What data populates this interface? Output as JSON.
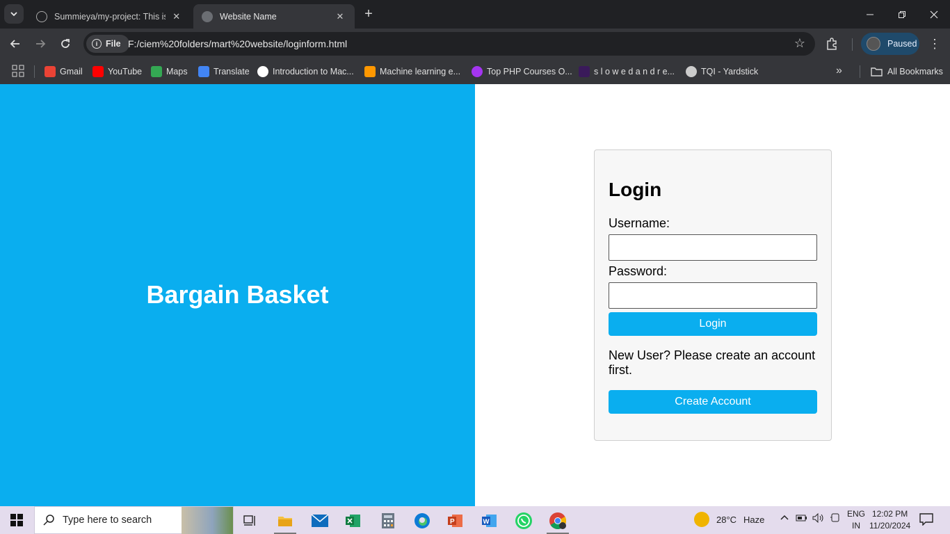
{
  "browser": {
    "tabs": [
      {
        "title": "Summieya/my-project: This is a"
      },
      {
        "title": "Website Name"
      }
    ],
    "address": {
      "chip": "File",
      "url": "F:/ciem%20folders/mart%20website/loginform.html"
    },
    "profile_label": "Paused",
    "bookmarks": [
      {
        "label": "Gmail",
        "color": "#ea4335"
      },
      {
        "label": "YouTube",
        "color": "#ff0000"
      },
      {
        "label": "Maps",
        "color": "#34a853"
      },
      {
        "label": "Translate",
        "color": "#4285f4"
      },
      {
        "label": "Introduction to Mac...",
        "color": "#ffffff"
      },
      {
        "label": "Machine learning e...",
        "color": "#ff9800"
      },
      {
        "label": "Top PHP Courses O...",
        "color": "#a435f0"
      },
      {
        "label": "s l o w e d a n d r e...",
        "color": "#3a1a5a"
      },
      {
        "label": "TQI - Yardstick",
        "color": "#cccccc"
      }
    ],
    "all_bookmarks": "All Bookmarks"
  },
  "page": {
    "brand": "Bargain Basket",
    "login": {
      "title": "Login",
      "username_label": "Username:",
      "username_value": "",
      "password_label": "Password:",
      "password_value": "",
      "login_button": "Login",
      "new_user_text": "New User? Please create an account first.",
      "create_button": "Create Account"
    },
    "colors": {
      "accent": "#0aaeef"
    }
  },
  "taskbar": {
    "search_placeholder": "Type here to search",
    "weather": {
      "temp": "28°C",
      "condition": "Haze"
    },
    "language": {
      "line1": "ENG",
      "line2": "IN"
    },
    "time": "12:02 PM",
    "date": "11/20/2024",
    "apps": [
      "task-view",
      "file-explorer",
      "mail",
      "excel",
      "calculator",
      "edge",
      "powerpoint",
      "word",
      "whatsapp",
      "chrome"
    ]
  }
}
